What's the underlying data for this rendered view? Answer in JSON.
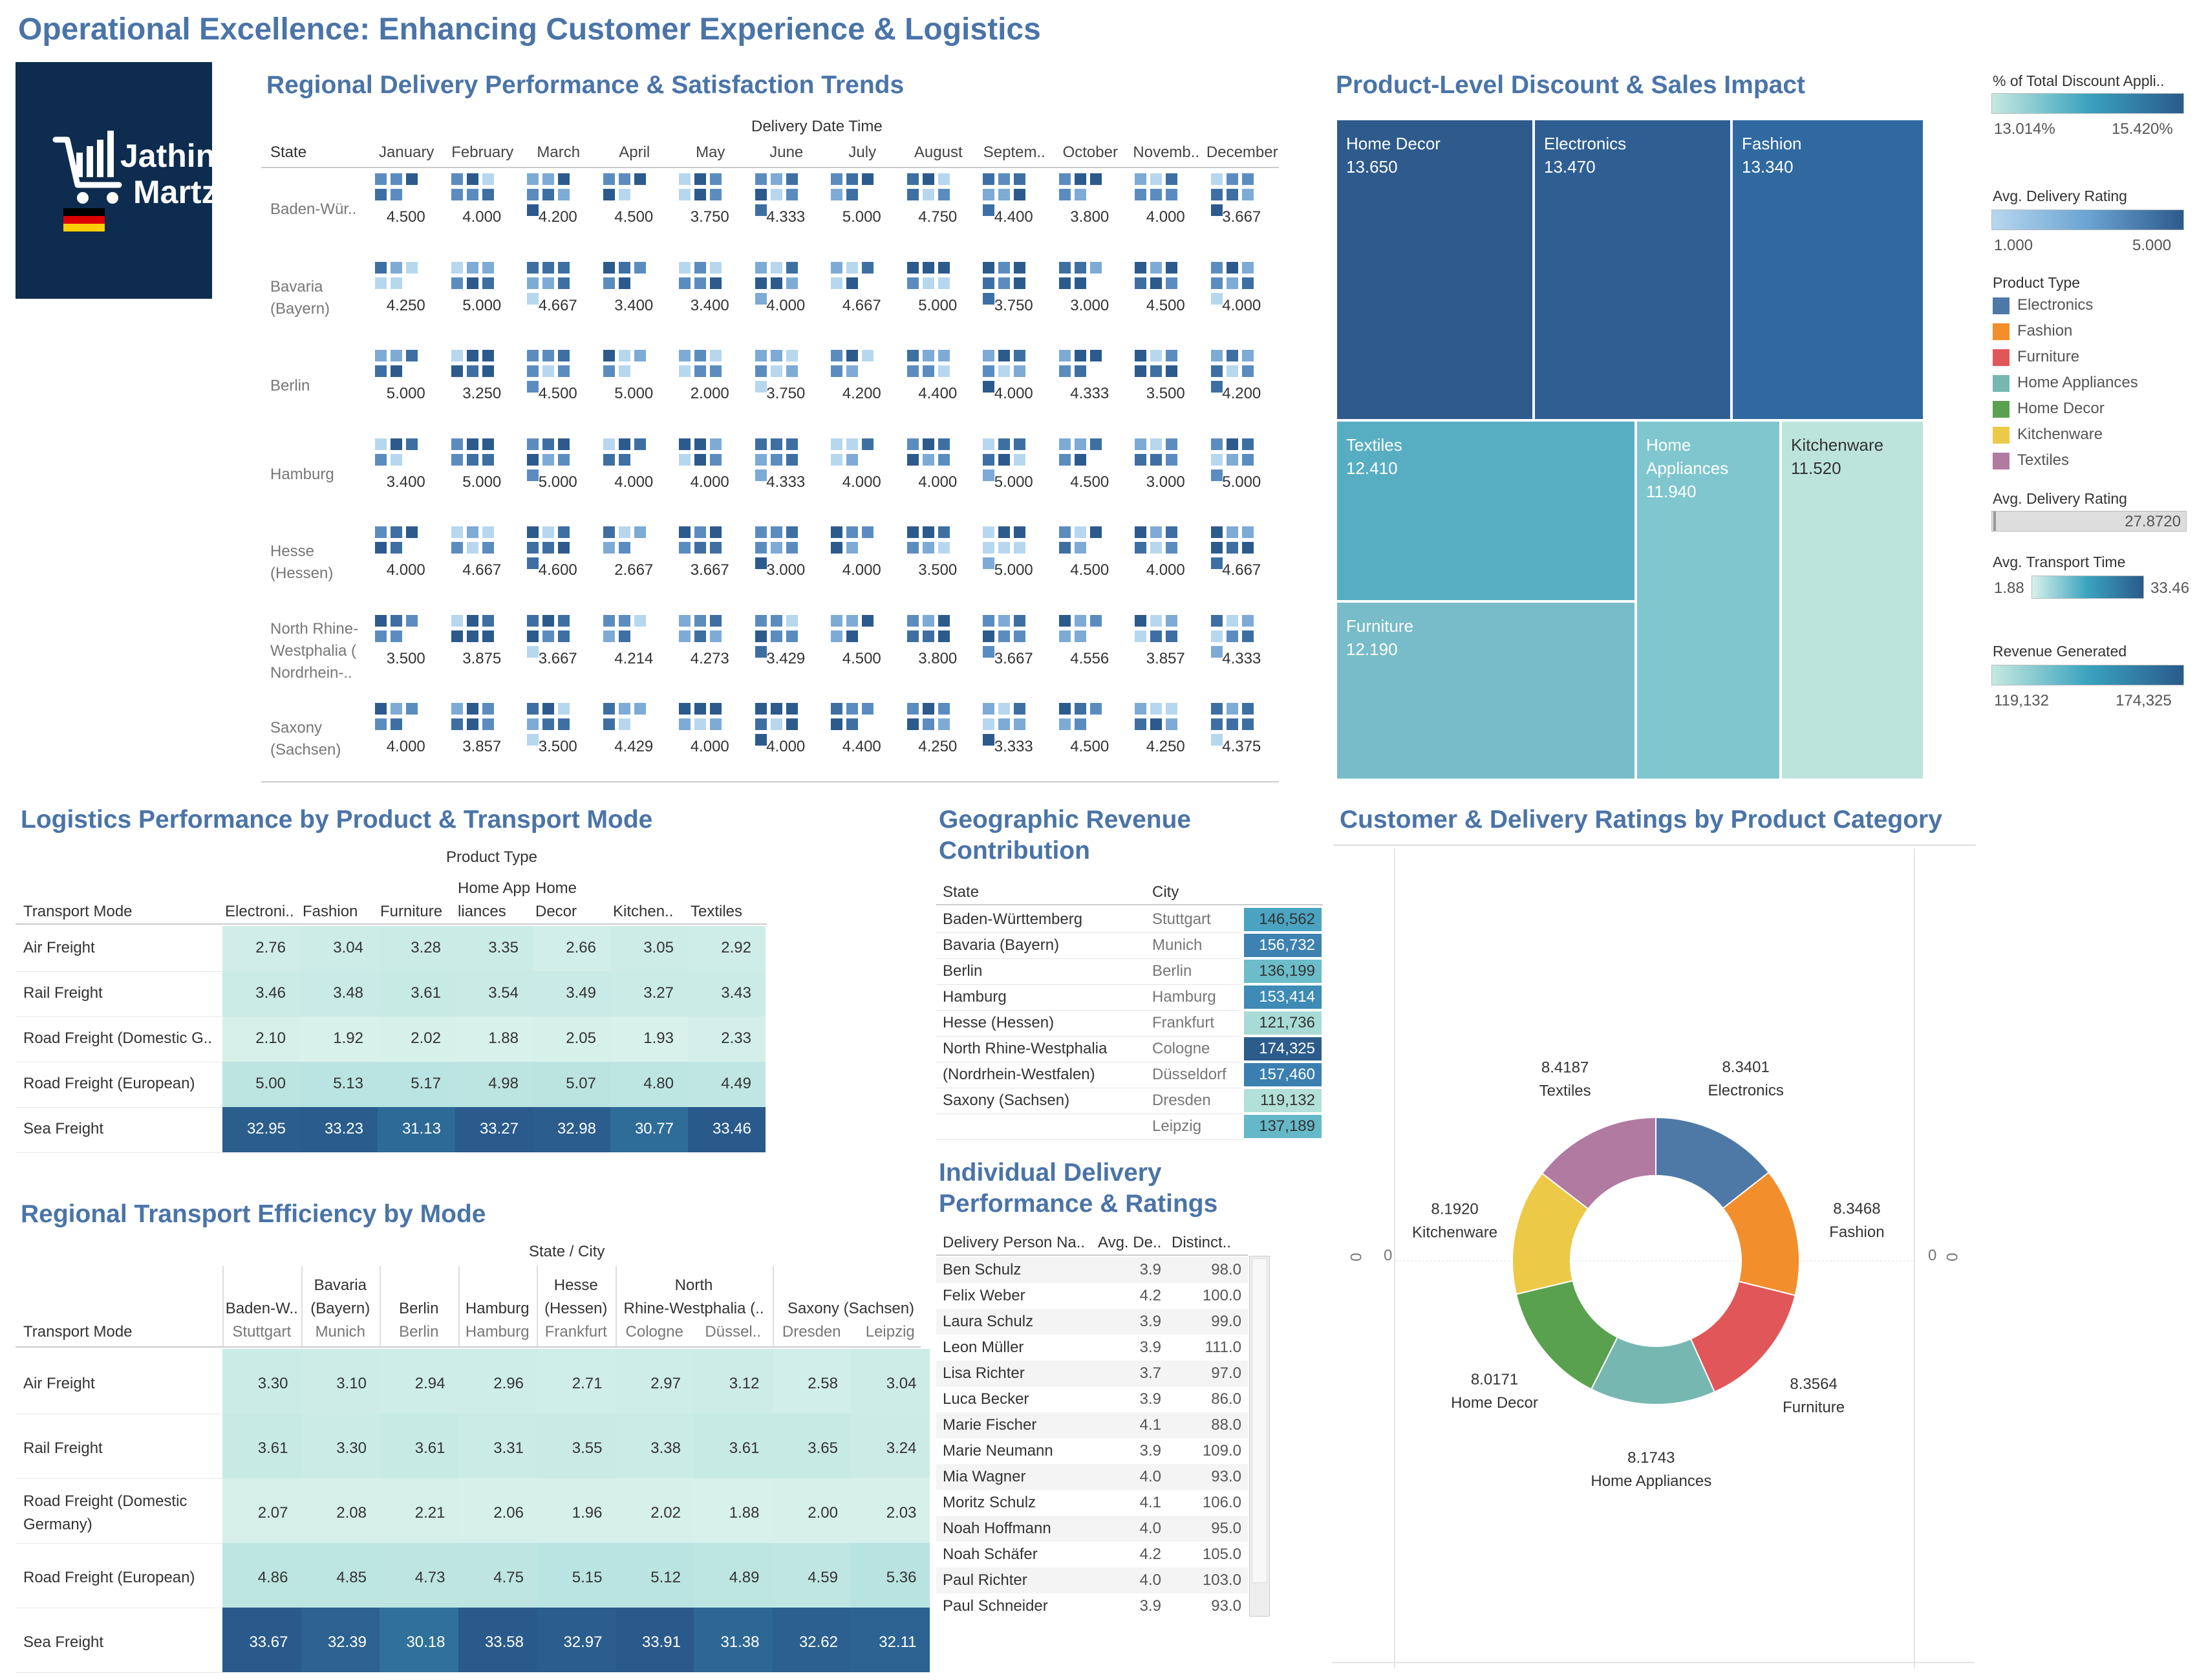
{
  "title": "Operational Excellence: Enhancing Customer Experience & Logistics",
  "logo": {
    "line1": "Jathin",
    "line2": "Martz"
  },
  "regional": {
    "title": "Regional Delivery Performance & Satisfaction Trends",
    "column_header": "Delivery Date Time",
    "row_header": "State",
    "months": [
      "January",
      "February",
      "March",
      "April",
      "May",
      "June",
      "July",
      "August",
      "Septem..",
      "October",
      "Novemb..",
      "December"
    ],
    "states": [
      {
        "name": [
          "Baden-Wür.."
        ],
        "values": [
          "4.500",
          "4.000",
          "4.200",
          "4.500",
          "3.750",
          "4.333",
          "5.000",
          "4.750",
          "4.400",
          "3.800",
          "4.000",
          "3.667"
        ]
      },
      {
        "name": [
          "Bavaria",
          "(Bayern)"
        ],
        "values": [
          "4.250",
          "5.000",
          "4.667",
          "3.400",
          "3.400",
          "4.000",
          "4.667",
          "5.000",
          "3.750",
          "3.000",
          "4.500",
          "4.000"
        ]
      },
      {
        "name": [
          "Berlin"
        ],
        "values": [
          "5.000",
          "3.250",
          "4.500",
          "5.000",
          "2.000",
          "3.750",
          "4.200",
          "4.400",
          "4.000",
          "4.333",
          "3.500",
          "4.200"
        ]
      },
      {
        "name": [
          "Hamburg"
        ],
        "values": [
          "3.400",
          "5.000",
          "5.000",
          "4.000",
          "4.000",
          "4.333",
          "4.000",
          "4.000",
          "5.000",
          "4.500",
          "3.000",
          "5.000"
        ]
      },
      {
        "name": [
          "Hesse",
          "(Hessen)"
        ],
        "values": [
          "4.000",
          "4.667",
          "4.600",
          "2.667",
          "3.667",
          "3.000",
          "4.000",
          "3.500",
          "5.000",
          "4.500",
          "4.000",
          "4.667"
        ]
      },
      {
        "name": [
          "North Rhine-",
          "Westphalia (",
          "Nordrhein-.."
        ],
        "values": [
          "3.500",
          "3.875",
          "3.667",
          "4.214",
          "4.273",
          "3.429",
          "4.500",
          "3.800",
          "3.667",
          "4.556",
          "3.857",
          "4.333"
        ]
      },
      {
        "name": [
          "Saxony",
          "(Sachsen)"
        ],
        "values": [
          "4.000",
          "3.857",
          "3.500",
          "4.429",
          "4.000",
          "4.000",
          "4.400",
          "4.250",
          "3.333",
          "4.500",
          "4.250",
          "4.375"
        ]
      }
    ]
  },
  "product_discount": {
    "title": "Product-Level Discount & Sales Impact",
    "cells": [
      {
        "name": "Home Decor",
        "value": "13.650",
        "color": "#2e5a8c"
      },
      {
        "name": "Electronics",
        "value": "13.470",
        "color": "#2f5f92"
      },
      {
        "name": "Fashion",
        "value": "13.340",
        "color": "#3069a0"
      },
      {
        "name": "Textiles",
        "value": "12.410",
        "color": "#57aec3"
      },
      {
        "name": "Home Appliances",
        "value": "11.940",
        "color": "#7fc6cf"
      },
      {
        "name": "Kitchenware",
        "value": "11.520",
        "color": "#bde4db"
      },
      {
        "name": "Furniture",
        "value": "12.190",
        "color": "#77bcc8"
      }
    ]
  },
  "legends": {
    "discount": {
      "title": "% of Total Discount Appli..",
      "min": "13.014%",
      "max": "15.420%"
    },
    "delivery_rating": {
      "title": "Avg. Delivery Rating",
      "min": "1.000",
      "max": "5.000"
    },
    "product_type": {
      "title": "Product Type",
      "items": [
        {
          "name": "Electronics",
          "color": "#4e79a7"
        },
        {
          "name": "Fashion",
          "color": "#f28e2b"
        },
        {
          "name": "Furniture",
          "color": "#e15759"
        },
        {
          "name": "Home Appliances",
          "color": "#76b7b2"
        },
        {
          "name": "Home Decor",
          "color": "#59a14f"
        },
        {
          "name": "Kitchenware",
          "color": "#edc948"
        },
        {
          "name": "Textiles",
          "color": "#b07aa1"
        }
      ]
    },
    "delivery_rating_bar": {
      "title": "Avg. Delivery Rating",
      "value": "27.8720"
    },
    "transport_time": {
      "title": "Avg. Transport Time",
      "min": "1.88",
      "max": "33.46"
    },
    "revenue": {
      "title": "Revenue Generated",
      "min": "119,132",
      "max": "174,325"
    }
  },
  "logistics": {
    "title": "Logistics Performance by Product & Transport Mode",
    "col_group": "Product Type",
    "row_header": "Transport Mode",
    "columns": [
      [
        "Electroni.."
      ],
      [
        "Fashion"
      ],
      [
        "Furniture"
      ],
      [
        "Home App",
        "liances"
      ],
      [
        "Home",
        "Decor"
      ],
      [
        "Kitchen.."
      ],
      [
        "Textiles"
      ]
    ],
    "rows": [
      {
        "mode": "Air Freight",
        "values": [
          "2.76",
          "3.04",
          "3.28",
          "3.35",
          "2.66",
          "3.05",
          "2.92"
        ]
      },
      {
        "mode": "Rail Freight",
        "values": [
          "3.46",
          "3.48",
          "3.61",
          "3.54",
          "3.49",
          "3.27",
          "3.43"
        ]
      },
      {
        "mode": "Road Freight (Domestic G..",
        "values": [
          "2.10",
          "1.92",
          "2.02",
          "1.88",
          "2.05",
          "1.93",
          "2.33"
        ]
      },
      {
        "mode": "Road Freight (European)",
        "values": [
          "5.00",
          "5.13",
          "5.17",
          "4.98",
          "5.07",
          "4.80",
          "4.49"
        ]
      },
      {
        "mode": "Sea Freight",
        "values": [
          "32.95",
          "33.23",
          "31.13",
          "33.27",
          "32.98",
          "30.77",
          "33.46"
        ]
      }
    ]
  },
  "geo": {
    "title": [
      "Geographic Revenue",
      "Contribution"
    ],
    "headers": {
      "state": "State",
      "city": "City"
    },
    "rows": [
      {
        "state": "Baden-Württemberg",
        "city": "Stuttgart",
        "value": "146,562",
        "color": "#4aa3c0"
      },
      {
        "state": "Bavaria (Bayern)",
        "city": "Munich",
        "value": "156,732",
        "color": "#3d82b0"
      },
      {
        "state": "Berlin",
        "city": "Berlin",
        "value": "136,199",
        "color": "#6cbcca"
      },
      {
        "state": "Hamburg",
        "city": "Hamburg",
        "value": "153,414",
        "color": "#3e8bb5"
      },
      {
        "state": "Hesse (Hessen)",
        "city": "Frankfurt",
        "value": "121,736",
        "color": "#a9dbd6"
      },
      {
        "state": "North Rhine-Westphalia",
        "state2": "(Nordrhein-Westfalen)",
        "city": "Cologne",
        "value": "174,325",
        "color": "#2b5c8c"
      },
      {
        "state": "",
        "city": "Düsseldorf",
        "value": "157,460",
        "color": "#3a7fb0"
      },
      {
        "state": "Saxony (Sachsen)",
        "city": "Dresden",
        "value": "119,132",
        "color": "#b3e0d8"
      },
      {
        "state": "",
        "city": "Leipzig",
        "value": "137,189",
        "color": "#65b8c8"
      }
    ]
  },
  "individual": {
    "title": [
      "Individual Delivery",
      "Performance & Ratings"
    ],
    "headers": [
      "Delivery Person Na..",
      "Avg. De..",
      "Distinct.."
    ],
    "rows": [
      {
        "name": "Ben Schulz",
        "avg": "3.9",
        "count": "98.0"
      },
      {
        "name": "Felix Weber",
        "avg": "4.2",
        "count": "100.0"
      },
      {
        "name": "Laura Schulz",
        "avg": "3.9",
        "count": "99.0"
      },
      {
        "name": "Leon Müller",
        "avg": "3.9",
        "count": "111.0"
      },
      {
        "name": "Lisa Richter",
        "avg": "3.7",
        "count": "97.0"
      },
      {
        "name": "Luca Becker",
        "avg": "3.9",
        "count": "86.0"
      },
      {
        "name": "Marie Fischer",
        "avg": "4.1",
        "count": "88.0"
      },
      {
        "name": "Marie Neumann",
        "avg": "3.9",
        "count": "109.0"
      },
      {
        "name": "Mia Wagner",
        "avg": "4.0",
        "count": "93.0"
      },
      {
        "name": "Moritz Schulz",
        "avg": "4.1",
        "count": "106.0"
      },
      {
        "name": "Noah Hoffmann",
        "avg": "4.0",
        "count": "95.0"
      },
      {
        "name": "Noah Schäfer",
        "avg": "4.2",
        "count": "105.0"
      },
      {
        "name": "Paul Richter",
        "avg": "4.0",
        "count": "103.0"
      },
      {
        "name": "Paul Schneider",
        "avg": "3.9",
        "count": "93.0"
      }
    ]
  },
  "regional_transport": {
    "title": "Regional Transport Efficiency by Mode",
    "col_group": "State / City",
    "row_header": "Transport Mode",
    "states": [
      [
        "Baden-W.."
      ],
      [
        "Bavaria",
        "(Bayern)"
      ],
      [
        "Berlin"
      ],
      [
        "Hamburg"
      ],
      [
        "Hesse",
        "(Hessen)"
      ],
      [
        "North",
        "Rhine-Westphalia (.."
      ],
      [
        "Saxony (Sachsen)"
      ]
    ],
    "cities": [
      "Stuttgart",
      "Munich",
      "Berlin",
      "Hamburg",
      "Frankfurt",
      "Cologne",
      "Düssel..",
      "Dresden",
      "Leipzig"
    ],
    "rows": [
      {
        "mode": [
          "Air Freight"
        ],
        "values": [
          "3.30",
          "3.10",
          "2.94",
          "2.96",
          "2.71",
          "2.97",
          "3.12",
          "2.58",
          "3.04"
        ]
      },
      {
        "mode": [
          "Rail Freight"
        ],
        "values": [
          "3.61",
          "3.30",
          "3.61",
          "3.31",
          "3.55",
          "3.38",
          "3.61",
          "3.65",
          "3.24"
        ]
      },
      {
        "mode": [
          "Road Freight (Domestic",
          "Germany)"
        ],
        "values": [
          "2.07",
          "2.08",
          "2.21",
          "2.06",
          "1.96",
          "2.02",
          "1.88",
          "2.00",
          "2.03"
        ]
      },
      {
        "mode": [
          "Road Freight (European)"
        ],
        "values": [
          "4.86",
          "4.85",
          "4.73",
          "4.75",
          "5.15",
          "5.12",
          "4.89",
          "4.59",
          "5.36"
        ]
      },
      {
        "mode": [
          "Sea Freight"
        ],
        "values": [
          "33.67",
          "32.39",
          "30.18",
          "33.58",
          "32.97",
          "33.91",
          "31.38",
          "32.62",
          "32.11"
        ]
      }
    ]
  },
  "ratings": {
    "title": "Customer & Delivery Ratings by Product Category",
    "axis_left": "0",
    "axis_right": "0"
  },
  "chart_data": {
    "type": "pie",
    "title": "Customer & Delivery Ratings by Product Category",
    "categories": [
      "Electronics",
      "Fashion",
      "Furniture",
      "Home Appliances",
      "Home Decor",
      "Kitchenware",
      "Textiles"
    ],
    "values": [
      8.3401,
      8.3468,
      8.3564,
      8.1743,
      8.0171,
      8.192,
      8.4187
    ],
    "labels": [
      "8.3401",
      "8.3468",
      "8.3564",
      "8.1743",
      "8.0171",
      "8.1920",
      "8.4187"
    ],
    "colors": [
      "#4e79a7",
      "#f28e2b",
      "#e15759",
      "#76b7b2",
      "#59a14f",
      "#edc948",
      "#b07aa1"
    ],
    "donut": true
  }
}
